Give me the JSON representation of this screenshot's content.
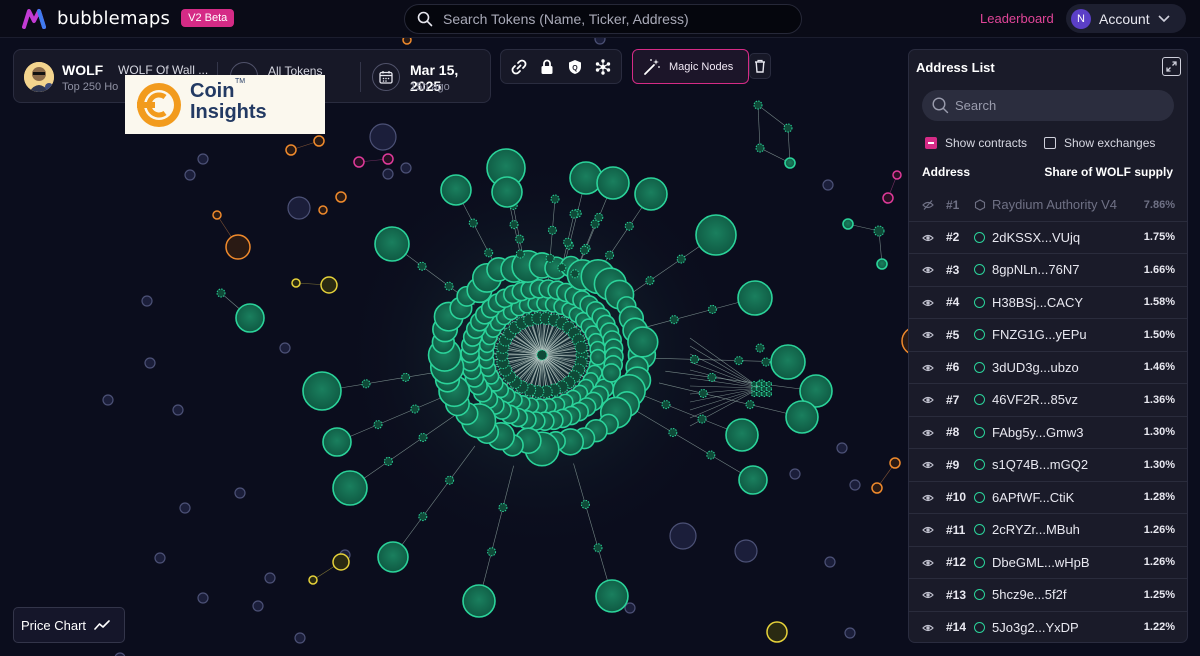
{
  "header": {
    "brand": "bubblemaps",
    "badge": "V2 Beta",
    "search_placeholder": "Search Tokens (Name, Ticker, Address)",
    "leaderboard": "Leaderboard",
    "account_initial": "N",
    "account_label": "Account"
  },
  "token": {
    "symbol": "WOLF",
    "name": "WOLF Of Wall ...",
    "subtitle": "Top 250 Ho",
    "scope_label": "All Tokens",
    "date": "Mar 15, 2025",
    "date_ago": "15h ago"
  },
  "watermark": {
    "line1": "Coin",
    "line2": "Insights",
    "tm": "TM"
  },
  "toolbar": {
    "magic_nodes": "Magic Nodes"
  },
  "price_chart": {
    "label": "Price Chart"
  },
  "address_list": {
    "title": "Address List",
    "search_placeholder": "Search",
    "show_contracts": "Show contracts",
    "show_exchanges": "Show exchanges",
    "col_address": "Address",
    "col_share": "Share of WOLF supply",
    "rows": [
      {
        "rank": "#1",
        "address": "Raydium Authority V4",
        "share": "7.86%"
      },
      {
        "rank": "#2",
        "address": "2dKSSX...VUjq",
        "share": "1.75%"
      },
      {
        "rank": "#3",
        "address": "8gpNLn...76N7",
        "share": "1.66%"
      },
      {
        "rank": "#4",
        "address": "H38BSj...CACY",
        "share": "1.58%"
      },
      {
        "rank": "#5",
        "address": "FNZG1G...yEPu",
        "share": "1.50%"
      },
      {
        "rank": "#6",
        "address": "3dUD3g...ubzo",
        "share": "1.46%"
      },
      {
        "rank": "#7",
        "address": "46VF2R...85vz",
        "share": "1.36%"
      },
      {
        "rank": "#8",
        "address": "FAbg5y...Gmw3",
        "share": "1.30%"
      },
      {
        "rank": "#9",
        "address": "s1Q74B...mGQ2",
        "share": "1.30%"
      },
      {
        "rank": "#10",
        "address": "6APfWF...CtiK",
        "share": "1.28%"
      },
      {
        "rank": "#11",
        "address": "2cRYZr...MBuh",
        "share": "1.26%"
      },
      {
        "rank": "#12",
        "address": "DbeGML...wHpB",
        "share": "1.26%"
      },
      {
        "rank": "#13",
        "address": "5hcz9e...5f2f",
        "share": "1.25%"
      },
      {
        "rank": "#14",
        "address": "5Jo3g2...YxDP",
        "share": "1.22%"
      }
    ]
  },
  "colors": {
    "accent_pink": "#d52b86",
    "holder_green": "#2bd39a",
    "background": "#0b0d1d"
  }
}
